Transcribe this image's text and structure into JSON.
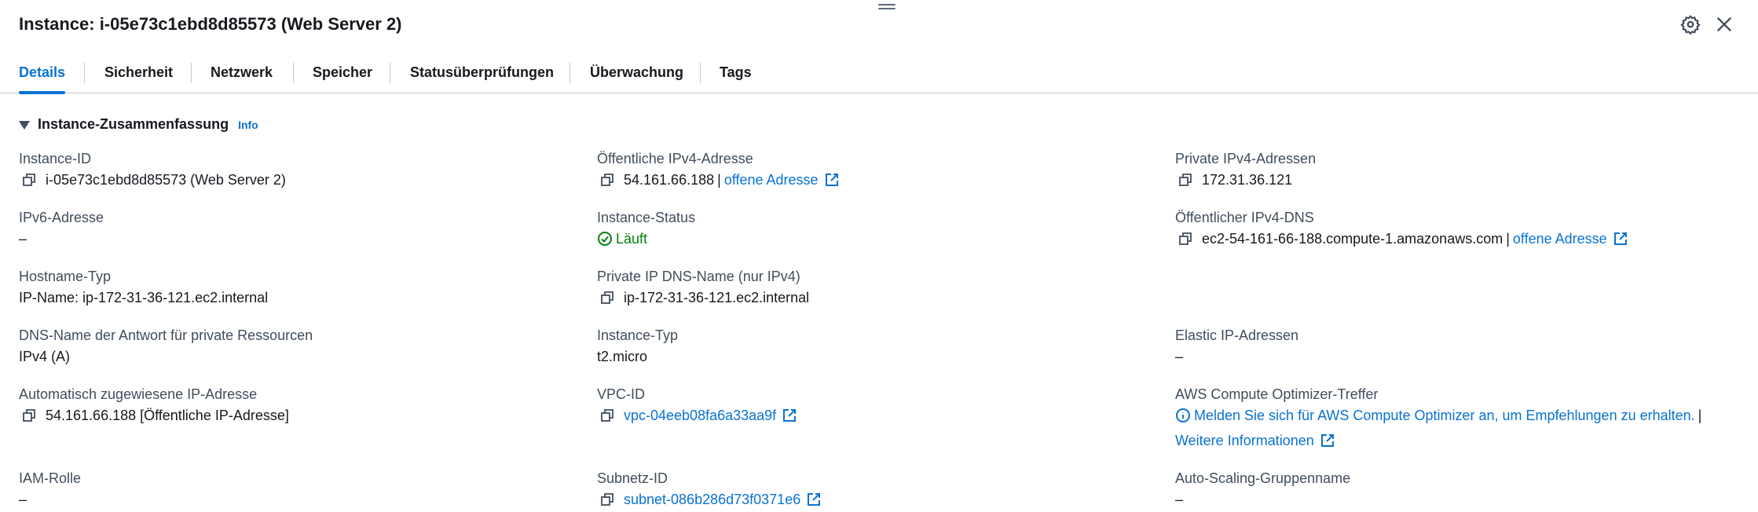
{
  "header": {
    "title": "Instance: i-05e73c1ebd8d85573 (Web Server 2)"
  },
  "tabs": [
    {
      "label": "Details"
    },
    {
      "label": "Sicherheit"
    },
    {
      "label": "Netzwerk"
    },
    {
      "label": "Speicher"
    },
    {
      "label": "Statusüberprüfungen"
    },
    {
      "label": "Überwachung"
    },
    {
      "label": "Tags"
    }
  ],
  "section": {
    "title": "Instance-Zusammenfassung",
    "info": "Info"
  },
  "col1": {
    "instance_id_label": "Instance-ID",
    "instance_id_value": "i-05e73c1ebd8d85573 (Web Server 2)",
    "ipv6_label": "IPv6-Adresse",
    "ipv6_value": "–",
    "hostname_label": "Hostname-Typ",
    "hostname_value": "IP-Name: ip-172-31-36-121.ec2.internal",
    "dns_answer_label": "DNS-Name der Antwort für private Ressourcen",
    "dns_answer_value": "IPv4 (A)",
    "auto_ip_label": "Automatisch zugewiesene IP-Adresse",
    "auto_ip_value": "54.161.66.188 [Öffentliche IP-Adresse]",
    "iam_label": "IAM-Rolle",
    "iam_value": "–"
  },
  "col2": {
    "public_ipv4_label": "Öffentliche IPv4-Adresse",
    "public_ipv4_value": "54.161.66.188",
    "public_ipv4_sep": "|",
    "public_ipv4_link": "offene Adresse",
    "status_label": "Instance-Status",
    "status_value": "Läuft",
    "private_dns_label": "Private IP DNS-Name (nur IPv4)",
    "private_dns_value": "ip-172-31-36-121.ec2.internal",
    "type_label": "Instance-Typ",
    "type_value": "t2.micro",
    "vpc_label": "VPC-ID",
    "vpc_value": "vpc-04eeb08fa6a33aa9f",
    "subnet_label": "Subnetz-ID",
    "subnet_value": "subnet-086b286d73f0371e6"
  },
  "col3": {
    "private_ipv4_label": "Private IPv4-Adressen",
    "private_ipv4_value": "172.31.36.121",
    "public_dns_label": "Öffentlicher IPv4-DNS",
    "public_dns_value": "ec2-54-161-66-188.compute-1.amazonaws.com",
    "public_dns_sep": "|",
    "public_dns_link": "offene Adresse",
    "elastic_label": "Elastic IP-Adressen",
    "elastic_value": "–",
    "optimizer_label": "AWS Compute Optimizer-Treffer",
    "optimizer_link": "Melden Sie sich für AWS Compute Optimizer an, um Empfehlungen zu erhalten.",
    "optimizer_sep": "|",
    "optimizer_more": "Weitere Informationen",
    "asg_label": "Auto-Scaling-Gruppenname",
    "asg_value": "–"
  },
  "colors": {
    "link": "#0972d3",
    "success": "#037f0c",
    "text": "#16191f",
    "label": "#414d5c"
  },
  "icons": [
    "drag-handle-icon",
    "settings-icon",
    "close-icon",
    "caret-down-icon",
    "copy-icon",
    "external-link-icon",
    "status-success-icon",
    "info-circle-icon"
  ]
}
